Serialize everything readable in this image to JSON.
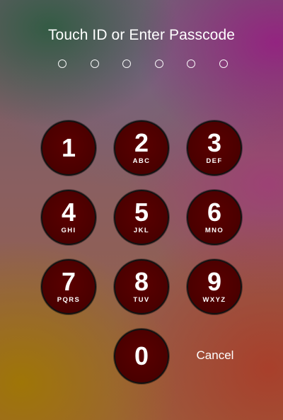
{
  "prompt": {
    "title": "Touch ID or Enter Passcode",
    "passcode_dots": 6
  },
  "keypad": {
    "keys": [
      {
        "digit": "1",
        "letters": ""
      },
      {
        "digit": "2",
        "letters": "ABC"
      },
      {
        "digit": "3",
        "letters": "DEF"
      },
      {
        "digit": "4",
        "letters": "GHI"
      },
      {
        "digit": "5",
        "letters": "JKL"
      },
      {
        "digit": "6",
        "letters": "MNO"
      },
      {
        "digit": "7",
        "letters": "PQRS"
      },
      {
        "digit": "8",
        "letters": "TUV"
      },
      {
        "digit": "9",
        "letters": "WXYZ"
      },
      {
        "digit": "0",
        "letters": ""
      }
    ],
    "cancel_label": "Cancel"
  },
  "colors": {
    "key_fill": "#4a0000",
    "key_border": "#111111",
    "text": "#ffffff"
  }
}
